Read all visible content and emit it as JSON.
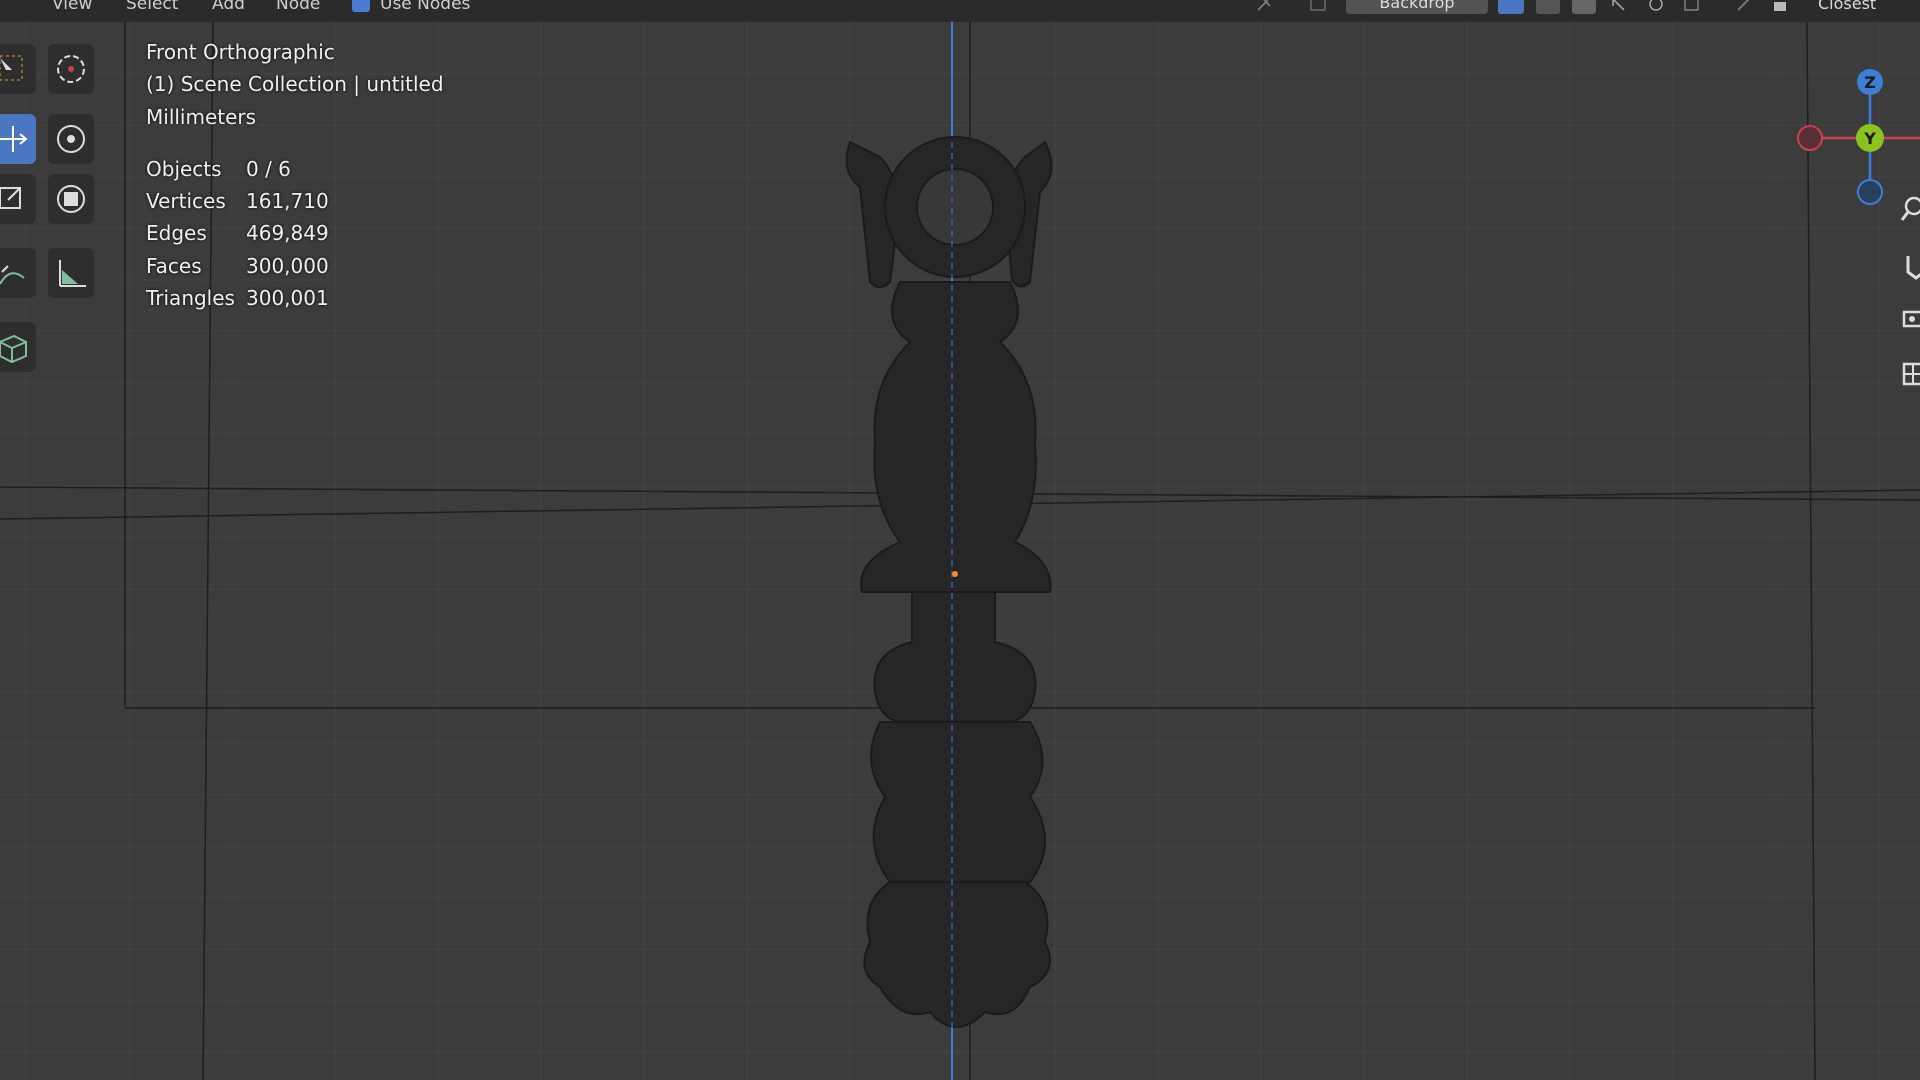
{
  "header": {
    "menu": [
      "View",
      "Select",
      "Add",
      "Node"
    ],
    "use_nodes_label": "Use Nodes",
    "backdrop_label": "Backdrop",
    "snap_label": "Closest"
  },
  "viewport": {
    "view_name": "Front Orthographic",
    "collection": "(1) Scene Collection | untitled",
    "units": "Millimeters",
    "stats": [
      {
        "label": "Objects",
        "value": "0 / 6"
      },
      {
        "label": "Vertices",
        "value": "161,710"
      },
      {
        "label": "Edges",
        "value": "469,849"
      },
      {
        "label": "Faces",
        "value": "300,000"
      },
      {
        "label": "Triangles",
        "value": "300,001"
      }
    ]
  },
  "toolbar": {
    "tools": [
      "select-box-icon",
      "cursor-icon",
      "move-icon",
      "rotate-icon",
      "scale-icon",
      "transform-icon",
      "annotate-icon",
      "measure-icon",
      "add-cube-icon"
    ],
    "active_tool": "move-icon"
  },
  "gizmo": {
    "axes": [
      "Z",
      "Y"
    ],
    "colors": {
      "x": "#c9404f",
      "y": "#8cc21e",
      "z": "#3b7fd6"
    }
  },
  "colors": {
    "viewport_bg": "#3c3c3c",
    "accent": "#4a76c2",
    "origin": "#ff8a1c"
  }
}
